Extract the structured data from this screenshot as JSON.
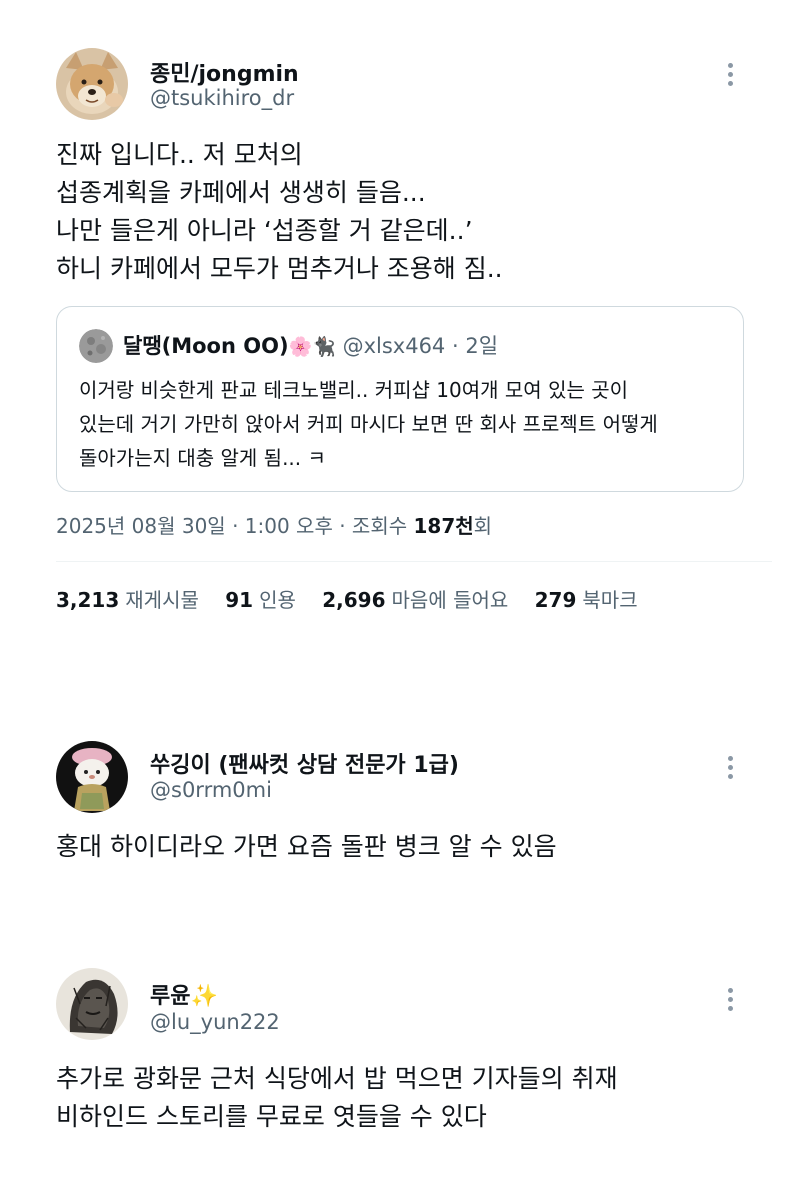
{
  "main_tweet": {
    "display_name": "종민/jongmin",
    "handle": "@tsukihiro_dr",
    "text_lines": [
      "진짜 입니다.. 저 모처의",
      "섭종계획을 카페에서 생생히 들음...",
      "나만 들은게 아니라 ‘섭종할 거 같은데..’",
      "하니 카페에서 모두가 멈추거나 조용해 짐.."
    ],
    "quoted": {
      "display_name": "달땡(Moon OO)",
      "emoji": "🌸🐈‍⬛",
      "handle": "@xlsx464",
      "time": "· 2일",
      "text_lines": [
        "이거랑 비슷한게 판교 테크노밸리.. 커피샵 10여개 모여 있는 곳이",
        "있는데 거기 가만히 앉아서 커피 마시다 보면 딴 회사 프로젝트 어떻게",
        "돌아가는지 대충 알게 됨... ㅋ"
      ]
    },
    "timestamp": "2025년 08월 30일 · 1:00 오후 · 조회수 ",
    "views_value": "187천",
    "views_suffix": "회",
    "stats": {
      "retweets_count": "3,213",
      "retweets_label": "재게시물",
      "quotes_count": "91",
      "quotes_label": "인용",
      "likes_count": "2,696",
      "likes_label": "마음에 들어요",
      "bookmarks_count": "279",
      "bookmarks_label": "북마크"
    }
  },
  "replies": [
    {
      "display_name": "쑤깅이 (팬싸컷 상담 전문가 1급)",
      "handle": "@s0rrm0mi",
      "text_lines": [
        "홍대 하이디라오 가면 요즘 돌판 병크 알 수 있음"
      ]
    },
    {
      "display_name": "루윤✨",
      "handle": "@lu_yun222",
      "text_lines": [
        "추가로 광화문 근처 식당에서 밥 먹으면 기자들의 취재",
        "비하인드 스토리를 무료로 엿들을 수 있다"
      ]
    }
  ],
  "icons": {
    "more": "more-vertical-icon"
  }
}
